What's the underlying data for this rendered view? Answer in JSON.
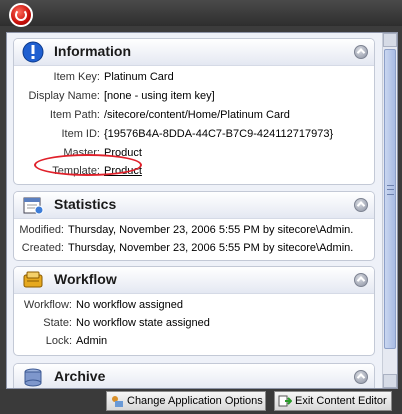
{
  "sections": {
    "information": {
      "title": "Information",
      "rows": [
        {
          "label": "Item Key:",
          "value": "Platinum Card"
        },
        {
          "label": "Display Name:",
          "value": "[none - using item key]"
        },
        {
          "label": "Item Path:",
          "value": "/sitecore/content/Home/Platinum Card"
        },
        {
          "label": "Item ID:",
          "value": "{19576B4A-8DDA-44C7-B7C9-424112717973}"
        },
        {
          "label": "Master:",
          "value": "Product"
        },
        {
          "label": "Template:",
          "value": "Product"
        }
      ]
    },
    "statistics": {
      "title": "Statistics",
      "rows": [
        {
          "label": "Modified:",
          "value": "Thursday, November 23, 2006 5:55 PM by sitecore\\Admin."
        },
        {
          "label": "Created:",
          "value": "Thursday, November 23, 2006 5:55 PM by sitecore\\Admin."
        }
      ]
    },
    "workflow": {
      "title": "Workflow",
      "rows": [
        {
          "label": "Workflow:",
          "value": "No workflow assigned"
        },
        {
          "label": "State:",
          "value": "No workflow state assigned"
        },
        {
          "label": "Lock:",
          "value": "Admin"
        }
      ]
    },
    "archive": {
      "title": "Archive"
    }
  },
  "bottom_buttons": {
    "change_options": "Change Application Options",
    "exit_editor": "Exit Content Editor"
  },
  "colors": {
    "highlight": "#e0202a",
    "info_icon": "#1f5fd0"
  }
}
